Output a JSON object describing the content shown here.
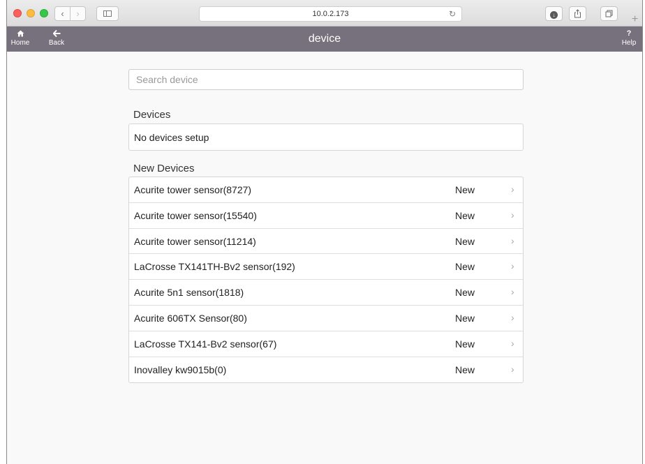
{
  "browser": {
    "url": "10.0.2.173",
    "nav_back_glyph": "‹",
    "nav_forward_glyph": "›",
    "reload_glyph": "↻",
    "new_tab_glyph": "+"
  },
  "header": {
    "home_label": "Home",
    "back_label": "Back",
    "title": "device",
    "help_glyph": "?",
    "help_label": "Help",
    "background_color": "#77707d"
  },
  "search": {
    "placeholder": "Search device",
    "value": ""
  },
  "devices": {
    "title": "Devices",
    "empty_text": "No devices setup"
  },
  "new_devices": {
    "title": "New Devices",
    "items": [
      {
        "name": "Acurite tower sensor(8727)",
        "status": "New"
      },
      {
        "name": "Acurite tower sensor(15540)",
        "status": "New"
      },
      {
        "name": "Acurite tower sensor(11214)",
        "status": "New"
      },
      {
        "name": "LaCrosse TX141TH-Bv2 sensor(192)",
        "status": "New"
      },
      {
        "name": "Acurite 5n1 sensor(1818)",
        "status": "New"
      },
      {
        "name": "Acurite 606TX Sensor(80)",
        "status": "New"
      },
      {
        "name": "LaCrosse TX141-Bv2 sensor(67)",
        "status": "New"
      },
      {
        "name": "Inovalley kw9015b(0)",
        "status": "New"
      }
    ]
  }
}
